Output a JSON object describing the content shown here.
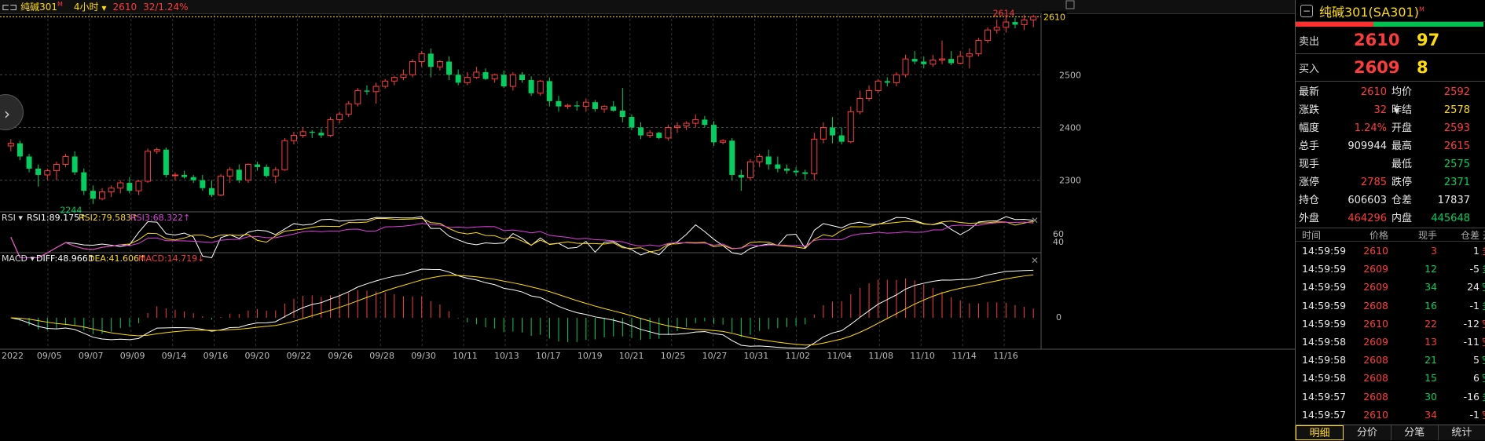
{
  "topbar": {
    "window_icon": "⊏⊐",
    "symbol": "纯碱301",
    "symbol_mark": "M",
    "period": "4小时",
    "price": "2610",
    "change": "32/1.24%"
  },
  "chart_data": {
    "type": "candlestick",
    "price_axis": {
      "ticks": [
        2300,
        2400,
        2500
      ],
      "current": "2610",
      "range": [
        2240,
        2615
      ]
    },
    "annotations": {
      "high": "2614",
      "low": "2244"
    },
    "x_labels": [
      "2022",
      "09/05",
      "09/07",
      "09/09",
      "09/14",
      "09/16",
      "09/20",
      "09/22",
      "09/26",
      "09/28",
      "09/30",
      "10/11",
      "10/13",
      "10/17",
      "10/19",
      "10/21",
      "10/25",
      "10/27",
      "10/31",
      "11/02",
      "11/04",
      "11/08",
      "11/10",
      "11/14",
      "11/16"
    ],
    "candles": [
      [
        2365,
        2378,
        2355,
        2370
      ],
      [
        2370,
        2375,
        2338,
        2345
      ],
      [
        2345,
        2350,
        2315,
        2322
      ],
      [
        2322,
        2330,
        2288,
        2310
      ],
      [
        2310,
        2322,
        2300,
        2318
      ],
      [
        2318,
        2335,
        2300,
        2330
      ],
      [
        2330,
        2350,
        2325,
        2345
      ],
      [
        2345,
        2355,
        2310,
        2315
      ],
      [
        2315,
        2322,
        2272,
        2280
      ],
      [
        2280,
        2290,
        2255,
        2265
      ],
      [
        2265,
        2285,
        2262,
        2278
      ],
      [
        2278,
        2290,
        2268,
        2285
      ],
      [
        2285,
        2300,
        2275,
        2295
      ],
      [
        2295,
        2306,
        2275,
        2280
      ],
      [
        2280,
        2300,
        2272,
        2298
      ],
      [
        2298,
        2360,
        2295,
        2355
      ],
      [
        2355,
        2362,
        2350,
        2358
      ],
      [
        2358,
        2362,
        2305,
        2310
      ],
      [
        2310,
        2315,
        2300,
        2310
      ],
      [
        2310,
        2318,
        2303,
        2306
      ],
      [
        2306,
        2310,
        2295,
        2300
      ],
      [
        2300,
        2310,
        2280,
        2285
      ],
      [
        2285,
        2300,
        2268,
        2272
      ],
      [
        2272,
        2312,
        2270,
        2308
      ],
      [
        2308,
        2325,
        2295,
        2320
      ],
      [
        2320,
        2330,
        2295,
        2300
      ],
      [
        2300,
        2332,
        2295,
        2330
      ],
      [
        2330,
        2335,
        2318,
        2325
      ],
      [
        2325,
        2330,
        2305,
        2308
      ],
      [
        2308,
        2325,
        2295,
        2320
      ],
      [
        2320,
        2380,
        2318,
        2375
      ],
      [
        2375,
        2392,
        2368,
        2385
      ],
      [
        2385,
        2400,
        2380,
        2392
      ],
      [
        2392,
        2395,
        2380,
        2390
      ],
      [
        2390,
        2398,
        2380,
        2385
      ],
      [
        2385,
        2420,
        2382,
        2415
      ],
      [
        2415,
        2430,
        2408,
        2425
      ],
      [
        2425,
        2450,
        2420,
        2445
      ],
      [
        2445,
        2475,
        2440,
        2470
      ],
      [
        2470,
        2480,
        2462,
        2468
      ],
      [
        2468,
        2485,
        2445,
        2478
      ],
      [
        2478,
        2492,
        2474,
        2488
      ],
      [
        2488,
        2498,
        2480,
        2495
      ],
      [
        2495,
        2510,
        2490,
        2500
      ],
      [
        2500,
        2530,
        2495,
        2525
      ],
      [
        2525,
        2545,
        2515,
        2540
      ],
      [
        2540,
        2550,
        2495,
        2515
      ],
      [
        2515,
        2528,
        2508,
        2525
      ],
      [
        2525,
        2535,
        2490,
        2500
      ],
      [
        2500,
        2510,
        2480,
        2485
      ],
      [
        2485,
        2505,
        2480,
        2495
      ],
      [
        2495,
        2515,
        2492,
        2505
      ],
      [
        2505,
        2512,
        2490,
        2492
      ],
      [
        2492,
        2502,
        2485,
        2500
      ],
      [
        2500,
        2508,
        2475,
        2478
      ],
      [
        2478,
        2505,
        2470,
        2500
      ],
      [
        2500,
        2505,
        2485,
        2490
      ],
      [
        2490,
        2497,
        2460,
        2465
      ],
      [
        2465,
        2490,
        2460,
        2488
      ],
      [
        2488,
        2495,
        2440,
        2450
      ],
      [
        2450,
        2460,
        2430,
        2440
      ],
      [
        2440,
        2445,
        2435,
        2442
      ],
      [
        2442,
        2450,
        2432,
        2440
      ],
      [
        2440,
        2455,
        2430,
        2448
      ],
      [
        2448,
        2452,
        2430,
        2435
      ],
      [
        2435,
        2442,
        2428,
        2440
      ],
      [
        2440,
        2450,
        2430,
        2432
      ],
      [
        2432,
        2475,
        2410,
        2420
      ],
      [
        2420,
        2425,
        2395,
        2400
      ],
      [
        2400,
        2410,
        2378,
        2385
      ],
      [
        2385,
        2395,
        2380,
        2390
      ],
      [
        2390,
        2392,
        2378,
        2380
      ],
      [
        2380,
        2405,
        2375,
        2400
      ],
      [
        2400,
        2410,
        2390,
        2403
      ],
      [
        2403,
        2412,
        2395,
        2408
      ],
      [
        2408,
        2425,
        2400,
        2415
      ],
      [
        2415,
        2422,
        2400,
        2405
      ],
      [
        2405,
        2412,
        2365,
        2372
      ],
      [
        2372,
        2378,
        2368,
        2375
      ],
      [
        2375,
        2380,
        2300,
        2310
      ],
      [
        2310,
        2320,
        2280,
        2305
      ],
      [
        2305,
        2340,
        2300,
        2335
      ],
      [
        2335,
        2350,
        2325,
        2345
      ],
      [
        2345,
        2358,
        2320,
        2330
      ],
      [
        2330,
        2345,
        2315,
        2322
      ],
      [
        2322,
        2330,
        2312,
        2318
      ],
      [
        2318,
        2325,
        2308,
        2315
      ],
      [
        2315,
        2320,
        2300,
        2312
      ],
      [
        2312,
        2390,
        2300,
        2378
      ],
      [
        2378,
        2410,
        2370,
        2400
      ],
      [
        2400,
        2420,
        2370,
        2385
      ],
      [
        2385,
        2400,
        2368,
        2373
      ],
      [
        2373,
        2440,
        2370,
        2430
      ],
      [
        2430,
        2470,
        2425,
        2455
      ],
      [
        2455,
        2480,
        2450,
        2470
      ],
      [
        2470,
        2492,
        2465,
        2488
      ],
      [
        2488,
        2495,
        2478,
        2485
      ],
      [
        2485,
        2505,
        2478,
        2500
      ],
      [
        2500,
        2538,
        2495,
        2530
      ],
      [
        2530,
        2545,
        2520,
        2525
      ],
      [
        2525,
        2535,
        2512,
        2520
      ],
      [
        2520,
        2538,
        2515,
        2528
      ],
      [
        2528,
        2565,
        2520,
        2530
      ],
      [
        2530,
        2545,
        2518,
        2522
      ],
      [
        2522,
        2545,
        2520,
        2535
      ],
      [
        2535,
        2550,
        2512,
        2540
      ],
      [
        2540,
        2570,
        2535,
        2565
      ],
      [
        2565,
        2590,
        2560,
        2585
      ],
      [
        2585,
        2605,
        2578,
        2590
      ],
      [
        2590,
        2612,
        2580,
        2600
      ],
      [
        2600,
        2608,
        2588,
        2595
      ],
      [
        2595,
        2614,
        2585,
        2604
      ],
      [
        2604,
        2614,
        2590,
        2610
      ]
    ],
    "rsi": {
      "label": "RSI",
      "rsi1": "RSI1:89.175↑",
      "rsi2": "RSI2:79.583↑",
      "rsi3": "RSI3:68.322↑",
      "levels": [
        60,
        40
      ]
    },
    "macd": {
      "label": "MACD",
      "diff": "DIFF:48.966↑",
      "dea": "DEA:41.606↑",
      "macd": "MACD:14.719↓",
      "zero": 0
    }
  },
  "panel": {
    "title": "纯碱301(SA301)",
    "title_mark": "M",
    "sell": {
      "label": "卖出",
      "price": "2610",
      "vol": "97"
    },
    "buy": {
      "label": "买入",
      "price": "2609",
      "vol": "8"
    },
    "stats": [
      {
        "l1": "最新",
        "v1": "2610",
        "c1": "red",
        "l2": "均价",
        "v2": "2592",
        "c2": "red",
        "arrow": "▼"
      },
      {
        "l1": "涨跌",
        "v1": "32",
        "c1": "red",
        "l2": "昨结",
        "v2": "2578",
        "c2": "yellow"
      },
      {
        "l1": "幅度",
        "v1": "1.24%",
        "c1": "red",
        "l2": "开盘",
        "v2": "2593",
        "c2": "red"
      },
      {
        "l1": "总手",
        "v1": "909944",
        "c1": "white",
        "l2": "最高",
        "v2": "2615",
        "c2": "red"
      },
      {
        "l1": "现手",
        "v1": "",
        "c1": "white",
        "l2": "最低",
        "v2": "2575",
        "c2": "green"
      },
      {
        "l1": "涨停",
        "v1": "2785",
        "c1": "red",
        "l2": "跌停",
        "v2": "2371",
        "c2": "green"
      },
      {
        "l1": "持仓",
        "v1": "606603",
        "c1": "white",
        "l2": "仓差",
        "v2": "17837",
        "c2": "white"
      },
      {
        "l1": "外盘",
        "v1": "464296",
        "c1": "red",
        "l2": "内盘",
        "v2": "445648",
        "c2": "green"
      }
    ],
    "ticks_header": [
      "时间",
      "价格",
      "现手",
      "仓差",
      "开平"
    ],
    "ticks": [
      {
        "t": "14:59:59",
        "p": "2610",
        "pc": "red",
        "v": "3",
        "vc": "red",
        "d": "1",
        "o": "多开",
        "oc": "red"
      },
      {
        "t": "14:59:59",
        "p": "2609",
        "pc": "red",
        "v": "12",
        "vc": "green",
        "d": "-5",
        "o": "多平",
        "oc": "green"
      },
      {
        "t": "14:59:59",
        "p": "2609",
        "pc": "red",
        "v": "34",
        "vc": "green",
        "d": "24",
        "o": "空开",
        "oc": "green"
      },
      {
        "t": "14:59:59",
        "p": "2608",
        "pc": "red",
        "v": "16",
        "vc": "green",
        "d": "-1",
        "o": "多平",
        "oc": "green"
      },
      {
        "t": "14:59:59",
        "p": "2610",
        "pc": "red",
        "v": "22",
        "vc": "red",
        "d": "-12",
        "o": "空平",
        "oc": "red"
      },
      {
        "t": "14:59:58",
        "p": "2609",
        "pc": "red",
        "v": "13",
        "vc": "red",
        "d": "-11",
        "o": "空平",
        "oc": "red"
      },
      {
        "t": "14:59:58",
        "p": "2608",
        "pc": "red",
        "v": "21",
        "vc": "green",
        "d": "5",
        "o": "空开",
        "oc": "green"
      },
      {
        "t": "14:59:58",
        "p": "2608",
        "pc": "red",
        "v": "15",
        "vc": "green",
        "d": "6",
        "o": "空开",
        "oc": "green"
      },
      {
        "t": "14:59:57",
        "p": "2608",
        "pc": "red",
        "v": "30",
        "vc": "green",
        "d": "-16",
        "o": "多平",
        "oc": "green"
      },
      {
        "t": "14:59:57",
        "p": "2610",
        "pc": "red",
        "v": "34",
        "vc": "red",
        "d": "-1",
        "o": "空平",
        "oc": "red"
      }
    ],
    "tabs": [
      "明细",
      "分价",
      "分笔",
      "统计"
    ]
  }
}
